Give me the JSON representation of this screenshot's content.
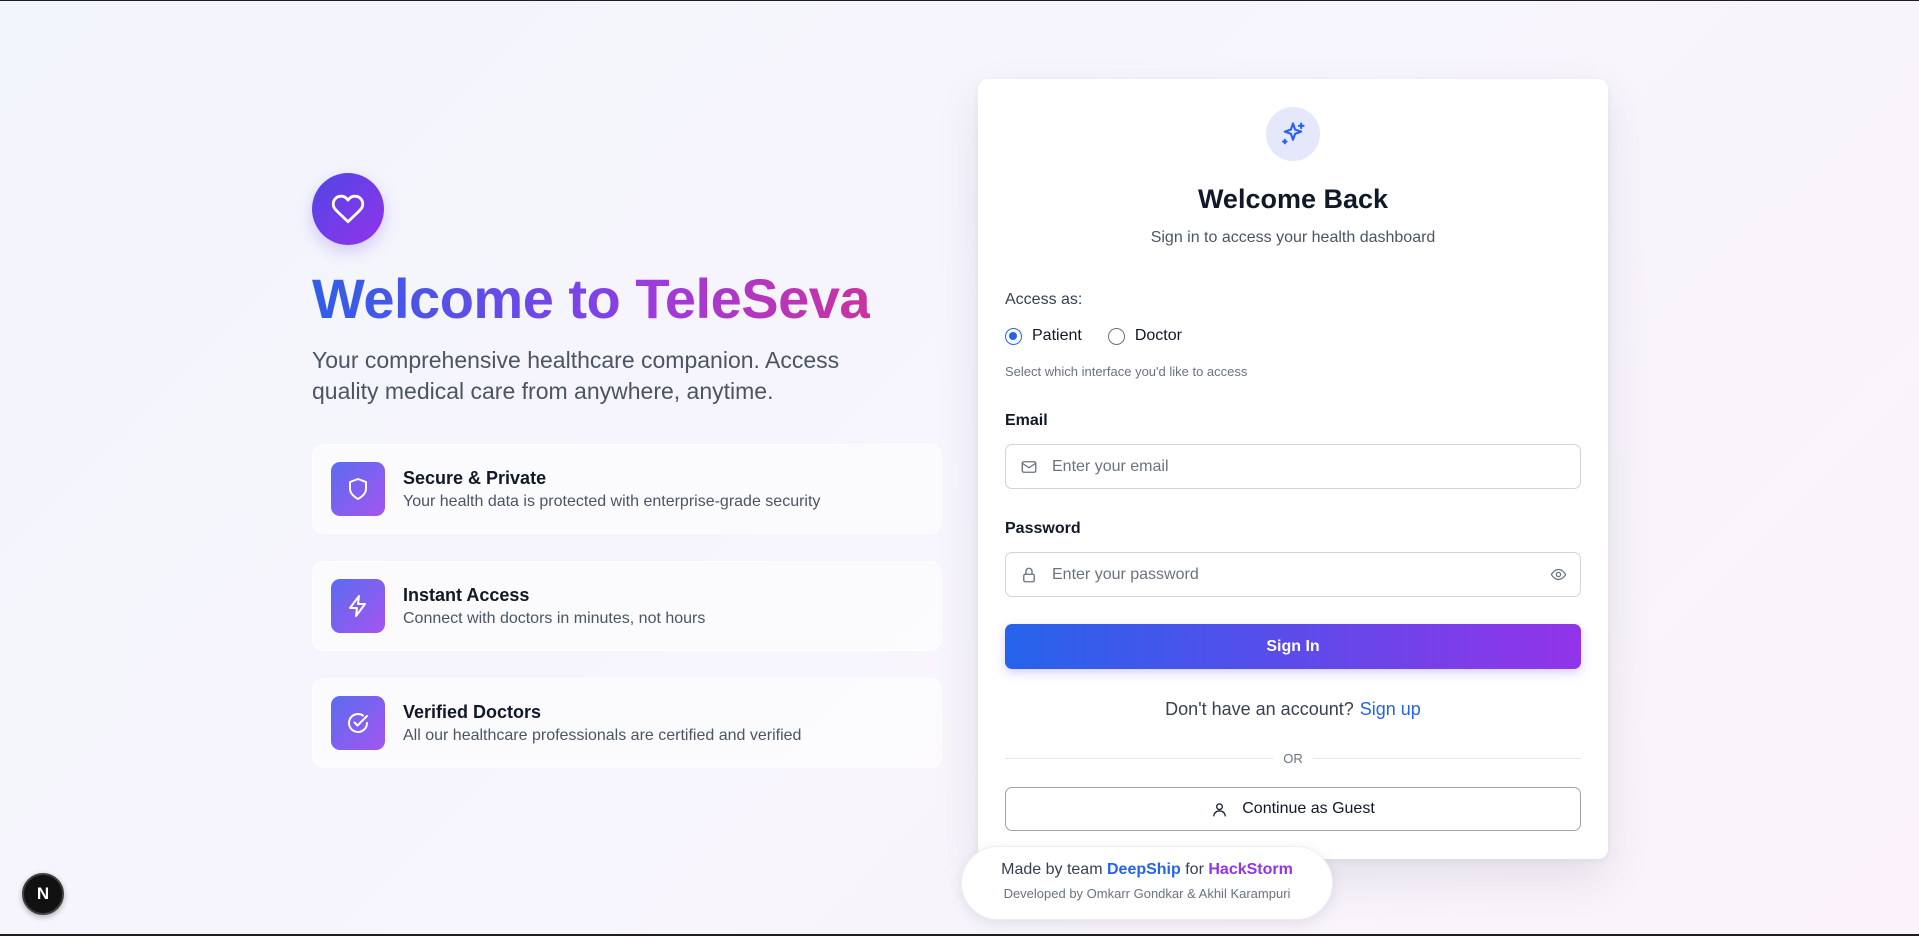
{
  "hero": {
    "title_part1": "Welcome to ",
    "title_part2": "TeleSeva",
    "subtitle": "Your comprehensive healthcare companion. Access quality medical care from anywhere, anytime.",
    "logo_icon": "heart-icon"
  },
  "features": [
    {
      "icon": "shield-icon",
      "title": "Secure & Private",
      "desc": "Your health data is protected with enterprise-grade security"
    },
    {
      "icon": "lightning-icon",
      "title": "Instant Access",
      "desc": "Connect with doctors in minutes, not hours"
    },
    {
      "icon": "check-circle-icon",
      "title": "Verified Doctors",
      "desc": "All our healthcare professionals are certified and verified"
    }
  ],
  "login": {
    "badge_icon": "sparkles-icon",
    "title": "Welcome Back",
    "subtitle": "Sign in to access your health dashboard",
    "access_label": "Access as:",
    "roles": [
      {
        "label": "Patient",
        "selected": true
      },
      {
        "label": "Doctor",
        "selected": false
      }
    ],
    "access_hint": "Select which interface you'd like to access",
    "email_label": "Email",
    "email_placeholder": "Enter your email",
    "password_label": "Password",
    "password_placeholder": "Enter your password",
    "signin_label": "Sign In",
    "no_account_text": "Don't have an account?",
    "signup_label": "Sign up",
    "or_text": "OR",
    "guest_label": "Continue as Guest"
  },
  "credit": {
    "made_by": "Made by team",
    "team": "DeepShip",
    "for_text": "for",
    "event": "HackStorm",
    "developed_by": "Developed by Omkarr Gondkar & Akhil Karampuri"
  },
  "dev_badge": {
    "label": "N"
  },
  "colors": {
    "primary": "#2563eb",
    "accent": "#9333ea",
    "title_pink": "#c9339e"
  }
}
